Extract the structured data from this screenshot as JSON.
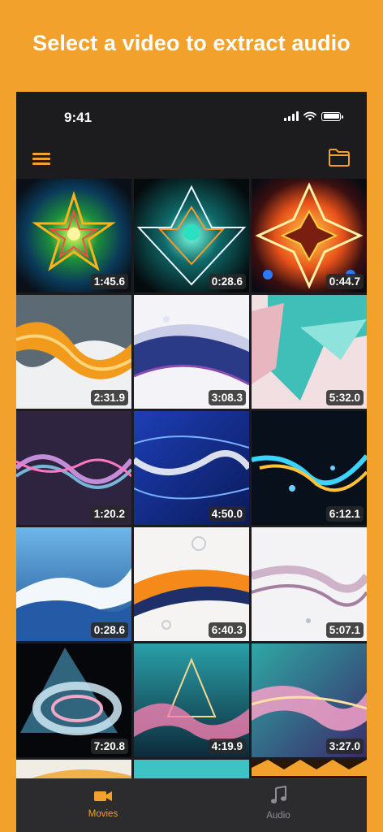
{
  "headline": "Select a video to extract audio",
  "status": {
    "time": "9:41"
  },
  "header": {
    "menu_icon": "menu-icon",
    "folder_icon": "folder-icon"
  },
  "videos": [
    {
      "duration": "1:45.6"
    },
    {
      "duration": "0:28.6"
    },
    {
      "duration": "0:44.7"
    },
    {
      "duration": "2:31.9"
    },
    {
      "duration": "3:08.3"
    },
    {
      "duration": "5:32.0"
    },
    {
      "duration": "1:20.2"
    },
    {
      "duration": "4:50.0"
    },
    {
      "duration": "6:12.1"
    },
    {
      "duration": "0:28.6"
    },
    {
      "duration": "6:40.3"
    },
    {
      "duration": "5:07.1"
    },
    {
      "duration": "7:20.8"
    },
    {
      "duration": "4:19.9"
    },
    {
      "duration": "3:27.0"
    }
  ],
  "tabs": [
    {
      "label": "Movies",
      "icon": "video-camera-icon",
      "active": true
    },
    {
      "label": "Audio",
      "icon": "music-note-icon",
      "active": false
    }
  ],
  "colors": {
    "accent": "#F2A22C",
    "background": "#1c1c1e"
  }
}
